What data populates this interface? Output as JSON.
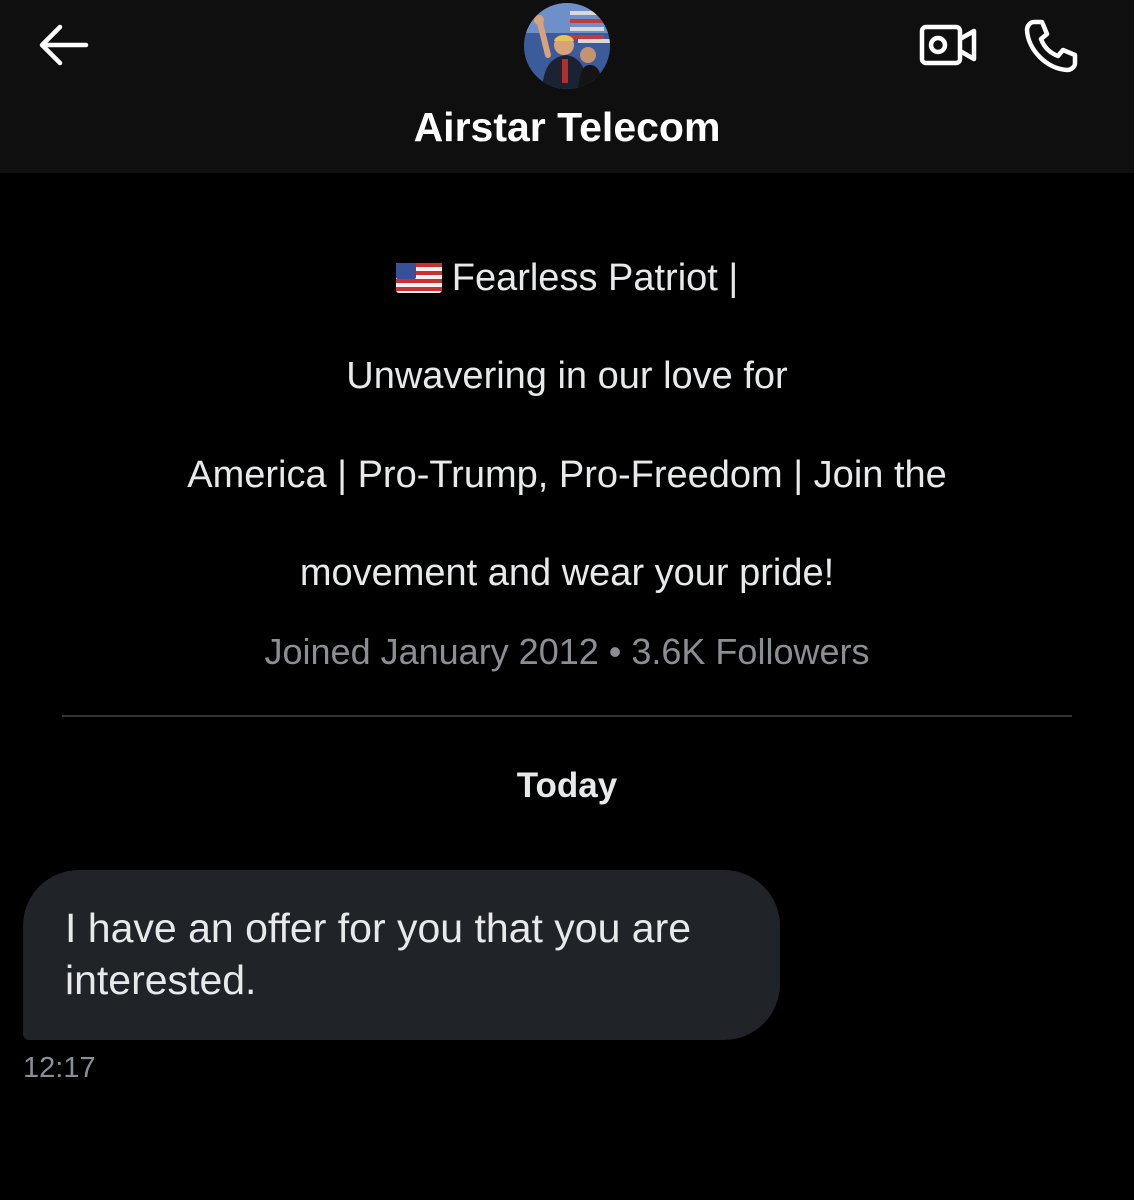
{
  "header": {
    "title": "Airstar Telecom",
    "back_icon": "arrow-left-icon",
    "video_icon": "video-camera-icon",
    "call_icon": "phone-icon"
  },
  "profile": {
    "bio_lines": [
      "Fearless Patriot |",
      "Unwavering in our love for",
      "America | Pro-Trump, Pro-Freedom | Join the",
      "movement and wear your pride!"
    ],
    "bio_flag_icon": "us-flag-emoji",
    "meta": "Joined January 2012 • 3.6K Followers"
  },
  "conversation": {
    "day_label": "Today",
    "messages": [
      {
        "text": "I have an offer for you that you are interested.",
        "time": "12:17"
      }
    ]
  },
  "colors": {
    "background": "#000000",
    "header_bg": "#0f0f0f",
    "bubble_bg": "#202327",
    "text_primary": "#e7e9ea",
    "text_secondary": "#8b8f94"
  }
}
